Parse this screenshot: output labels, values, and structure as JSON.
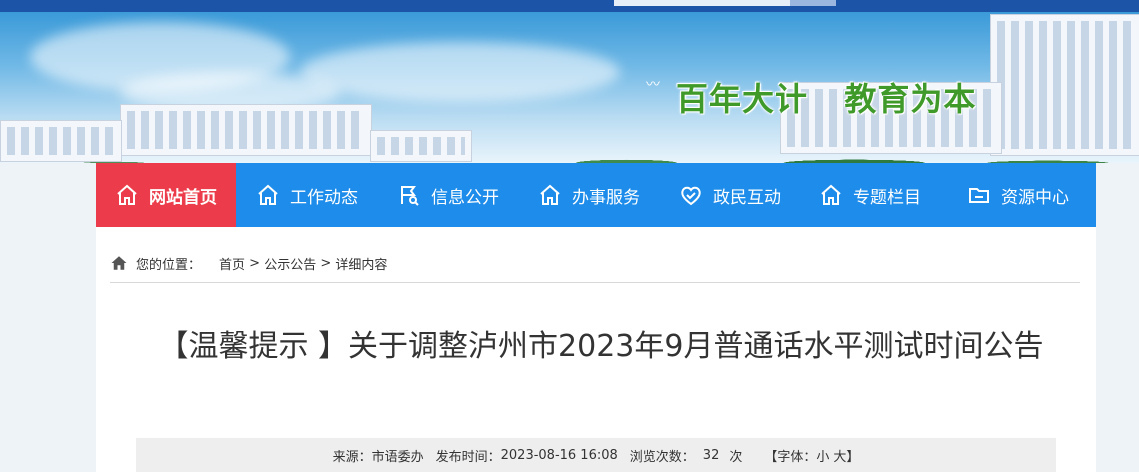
{
  "banner": {
    "slogan": "百年大计   教育为本"
  },
  "nav": {
    "items": [
      {
        "label": "网站首页",
        "icon": "home-icon"
      },
      {
        "label": "工作动态",
        "icon": "home-icon"
      },
      {
        "label": "信息公开",
        "icon": "flag-search-icon"
      },
      {
        "label": "办事服务",
        "icon": "home-icon"
      },
      {
        "label": "政民互动",
        "icon": "heart-check-icon"
      },
      {
        "label": "专题栏目",
        "icon": "home-icon"
      },
      {
        "label": "资源中心",
        "icon": "folder-icon"
      }
    ],
    "active_color": "#ec3b4a",
    "bar_color": "#1e8cea"
  },
  "breadcrumb": {
    "prefix": "您的位置：",
    "home": "首页",
    "sep1": " > ",
    "section": "公示公告",
    "sep2": " > ",
    "current": "详细内容"
  },
  "article": {
    "title": "【温馨提示 】关于调整泸州市2023年9月普通话水平测试时间公告",
    "meta": {
      "source_label": "来源：",
      "source": "市语委办",
      "time_label": "发布时间：",
      "time": "2023-08-16 16:08",
      "views_label": "浏览次数：",
      "views": "32",
      "views_unit": "次",
      "font_label": "【字体：",
      "font_small": "小",
      "font_large": "大",
      "font_close": "】"
    }
  }
}
